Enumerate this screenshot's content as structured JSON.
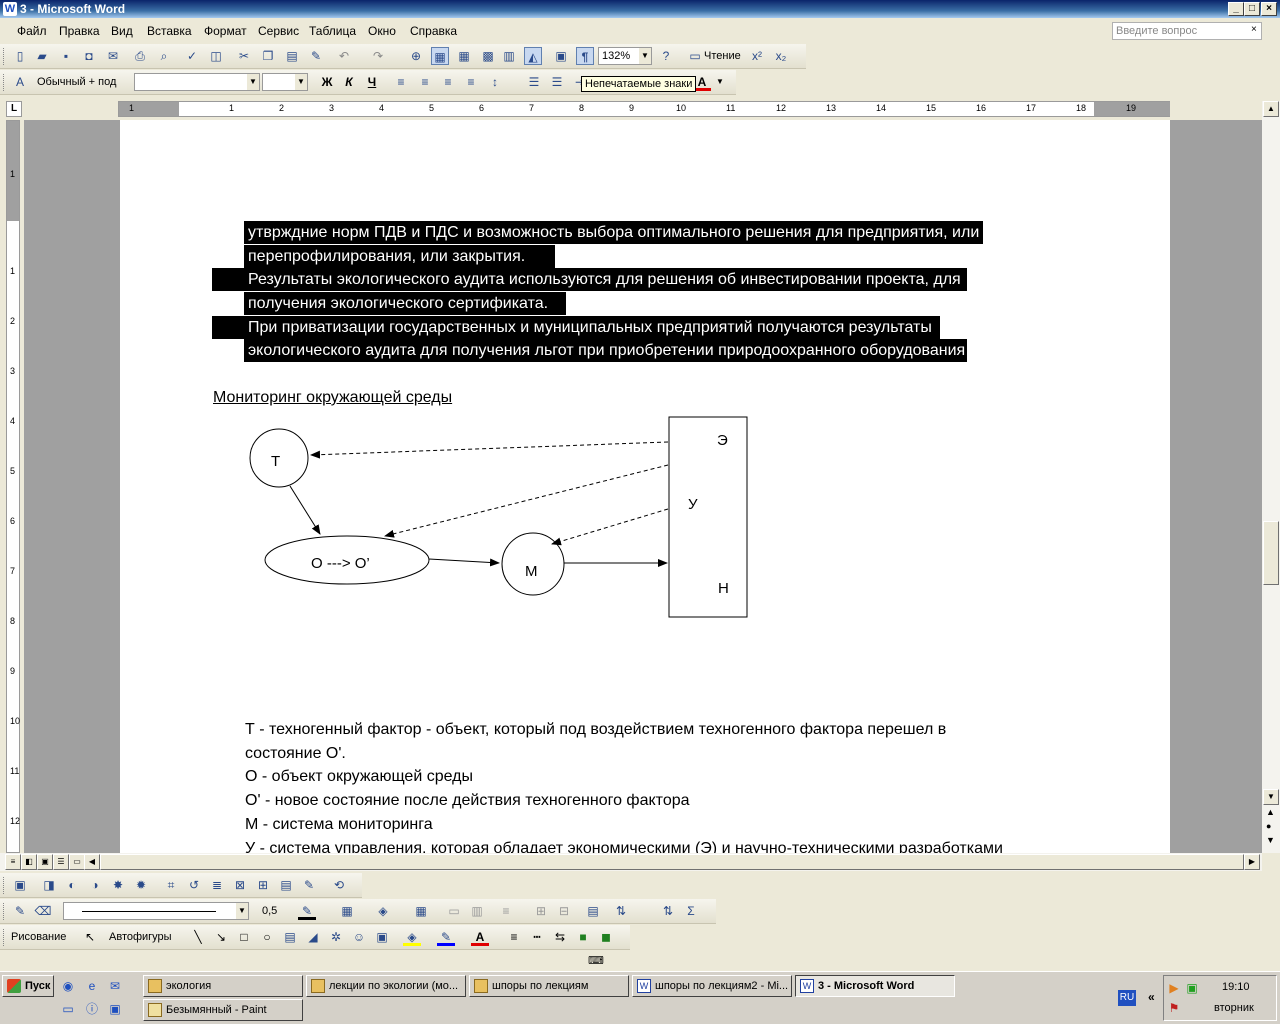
{
  "window": {
    "title": "3 - Microsoft Word"
  },
  "menu": {
    "items": [
      "Файл",
      "Правка",
      "Вид",
      "Вставка",
      "Формат",
      "Сервис",
      "Таблица",
      "Окно",
      "Справка"
    ],
    "ask_placeholder": "Введите вопрос"
  },
  "toolbar_standard": {
    "zoom": "132%",
    "reading": "Чтение"
  },
  "toolbar_format": {
    "style": "Обычный + под",
    "font": "",
    "size": "",
    "bold": "Ж",
    "italic": "К",
    "underline": "Ч"
  },
  "tooltip": "Непечатаемые знаки",
  "ruler_h_numbers": [
    "1",
    "1",
    "2",
    "3",
    "4",
    "5",
    "6",
    "7",
    "8",
    "9",
    "10",
    "11",
    "12",
    "13",
    "14",
    "15",
    "16",
    "17",
    "18",
    "19"
  ],
  "ruler_v_numbers": [
    "1",
    "1",
    "2",
    "3",
    "4",
    "5",
    "6",
    "7",
    "8",
    "9",
    "10",
    "11",
    "12"
  ],
  "document": {
    "highlighted_lines": [
      "утврждние норм ПДВ и ПДС и возможность выбора оптимального решения для предприятия, или",
      "перепрофилирования, или закрытия.",
      "Результаты экологического аудита используются для решения об инвестировании проекта, для",
      "получения экологического сертификата.",
      "При приватизации государственных и муниципальных предприятий получаются результаты",
      "экологического аудита для получения льгот при приобретении природоохранного оборудования"
    ],
    "heading": "Мониторинг окружающей среды",
    "diagram": {
      "t": "Т",
      "o": "О ---> О’",
      "m": "М",
      "e": "Э",
      "u": "У",
      "n": "Н"
    },
    "legend_lines": [
      "Т - техногенный фактор - объект, который под воздействием техногенного фактора перешел в",
      "состояние О'.",
      "О - объект окружающей среды",
      "О' - новое состояние после действия техногенного фактора",
      "М - система мониторинга",
      "У - система управления, которая обладает экономическими (Э) и научно-техническими разработками"
    ]
  },
  "toolbar_picture": {
    "line_width": "0,5"
  },
  "toolbar_drawing": {
    "draw": "Рисование",
    "autoshapes": "Автофигуры"
  },
  "taskbar": {
    "start": "Пуск",
    "tasks": [
      "экология",
      "лекции по экологии (мо...",
      "шпоры по лекциям",
      "шпоры по лекциям2 - Mi...",
      "3 - Microsoft Word",
      "Безымянный - Paint"
    ],
    "lang": "RU",
    "time": "19:10",
    "day": "вторник"
  },
  "colors": {
    "title_bar": "#0A246A",
    "highlight_bg": "#000000",
    "page_bg": "#FFFFFF",
    "workspace": "#A0A0A0"
  }
}
